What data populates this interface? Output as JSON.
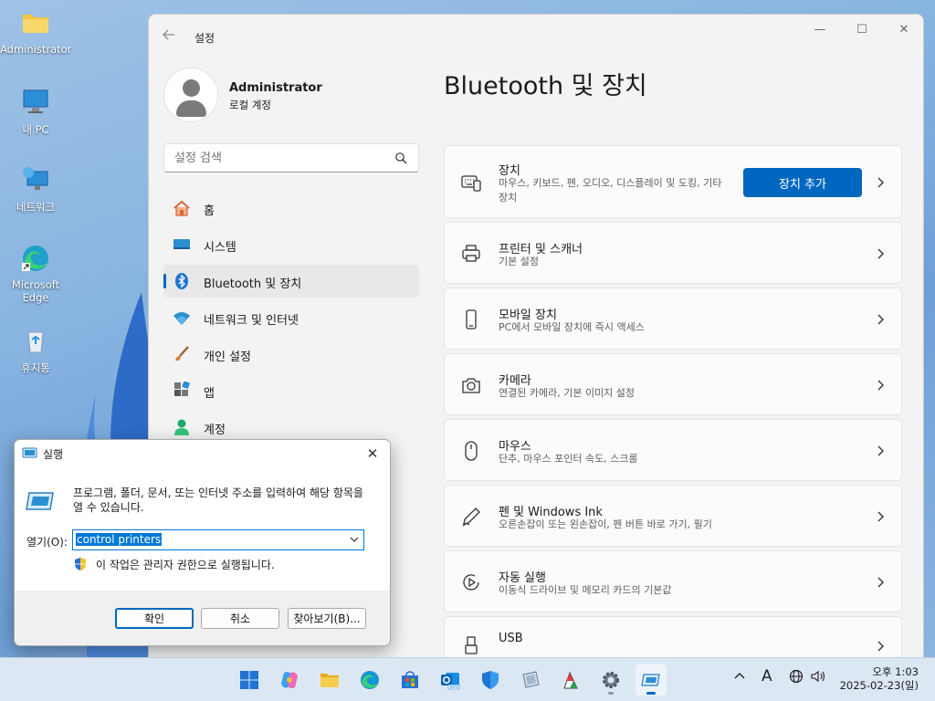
{
  "desktop": {
    "icons": [
      {
        "label": "Administrator"
      },
      {
        "label": "내 PC"
      },
      {
        "label": "네트워크"
      },
      {
        "label": "Microsoft Edge"
      },
      {
        "label": "휴지통"
      }
    ]
  },
  "settings": {
    "title": "설정",
    "user": {
      "name": "Administrator",
      "account_type": "로컬 계정"
    },
    "search_placeholder": "설정 검색",
    "nav": [
      {
        "label": "홈",
        "icon": "home-icon"
      },
      {
        "label": "시스템",
        "icon": "monitor-icon"
      },
      {
        "label": "Bluetooth 및 장치",
        "icon": "bluetooth-icon",
        "selected": true
      },
      {
        "label": "네트워크 및 인터넷",
        "icon": "wifi-icon"
      },
      {
        "label": "개인 설정",
        "icon": "brush-icon"
      },
      {
        "label": "앱",
        "icon": "apps-icon"
      },
      {
        "label": "계정",
        "icon": "person-icon"
      }
    ],
    "page_title": "Bluetooth 및 장치",
    "cards": [
      {
        "title": "장치",
        "desc": "마우스, 키보드, 펜, 오디오, 디스플레이 및 도킹, 기타 장치",
        "icon": "devices-icon",
        "button": "장치 추가"
      },
      {
        "title": "프린터 및 스캐너",
        "desc": "기본 설정",
        "icon": "printer-icon"
      },
      {
        "title": "모바일 장치",
        "desc": "PC에서 모바일 장치에 즉시 액세스",
        "icon": "phone-icon"
      },
      {
        "title": "카메라",
        "desc": "연결된 카메라, 기본 이미지 설정",
        "icon": "camera-icon"
      },
      {
        "title": "마우스",
        "desc": "단추, 마우스 포인터 속도, 스크롤",
        "icon": "mouse-icon"
      },
      {
        "title": "펜 및 Windows Ink",
        "desc": "오른손잡이 또는 왼손잡이, 펜 버튼 바로 가기, 필기",
        "icon": "pen-icon"
      },
      {
        "title": "자동 실행",
        "desc": "이동식 드라이브 및 메모리 카드의 기본값",
        "icon": "autoplay-icon"
      },
      {
        "title": "USB",
        "desc": "",
        "icon": "usb-icon"
      }
    ]
  },
  "run_dialog": {
    "title": "실행",
    "description": "프로그램, 폴더, 문서, 또는 인터넷 주소를 입력하여 해당 항목을 열 수 있습니다.",
    "open_label": "열기(O):",
    "input_value": "control printers",
    "admin_note": "이 작업은 관리자 권한으로 실행됩니다.",
    "ok": "확인",
    "cancel": "취소",
    "browse": "찾아보기(B)..."
  },
  "taskbar": {
    "apps": [
      "windows-start-icon",
      "copilot-icon",
      "file-explorer-icon",
      "edge-icon",
      "store-icon",
      "outlook-icon",
      "defender-icon",
      "snipping-icon",
      "paint-icon",
      "settings-gear-icon",
      "run-icon"
    ],
    "tray": {
      "input_indicator": "A"
    },
    "clock": {
      "time": "오후 1:03",
      "date": "2025-02-23(일)"
    }
  },
  "colors": {
    "accent": "#0067c0",
    "selected_nav": "#e8e8e8"
  }
}
